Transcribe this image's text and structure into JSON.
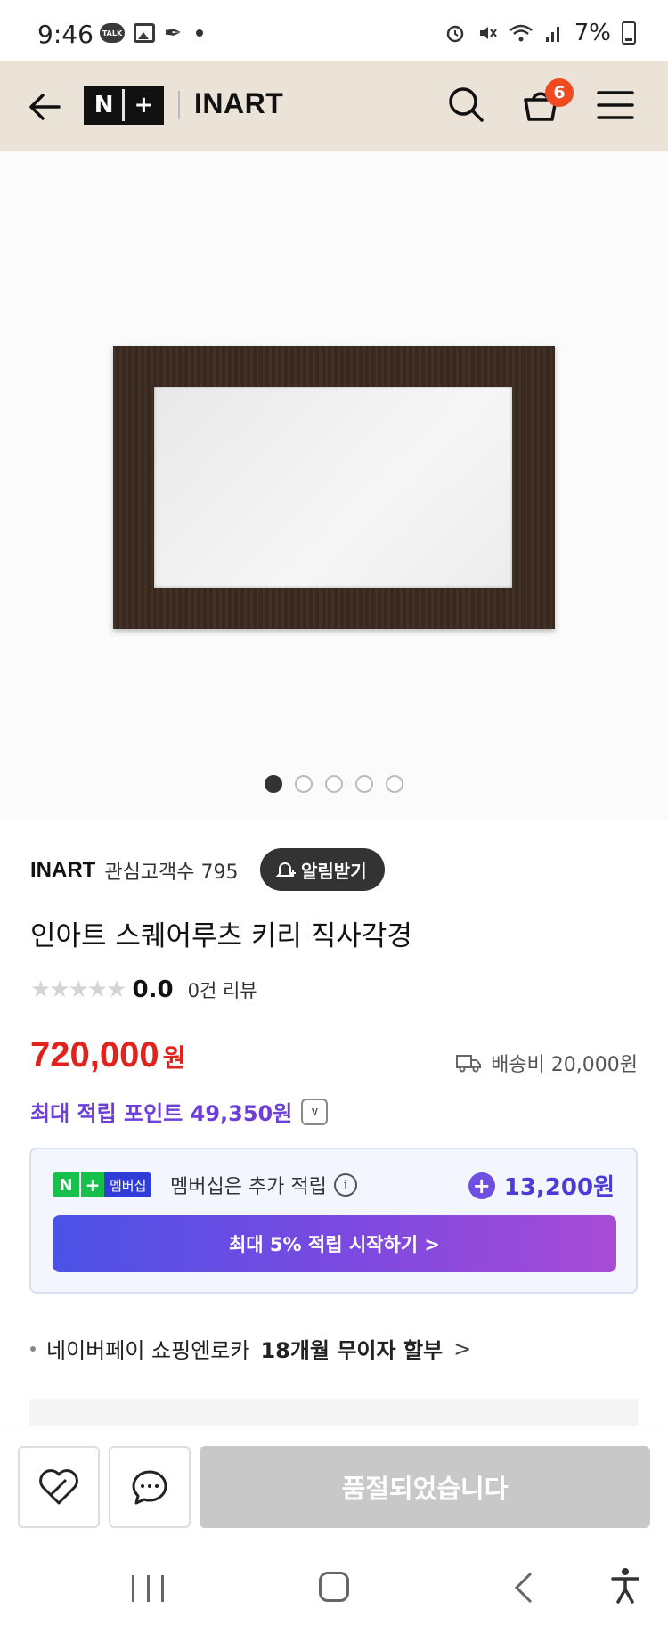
{
  "status_bar": {
    "time": "9:46",
    "talk_label": "TALK",
    "battery": "7%"
  },
  "header": {
    "logo": "N+",
    "logo_n": "N",
    "logo_plus": "+",
    "store_name": "INART",
    "cart_count": "6",
    "bg_color": "#ebe3d8"
  },
  "gallery": {
    "image_count": 5,
    "active_index": 0
  },
  "product": {
    "seller": "INART",
    "fans": "관심고객수 795",
    "alarm_label": "알림받기",
    "title": "인아트 스퀘어루츠 키리 직사각경",
    "stars": "★★★★★",
    "rating": "0.0",
    "reviews": "0건 리뷰",
    "price": "720,000",
    "currency": "원",
    "shipping": "배송비 20,000원",
    "points": "최대 적립 포인트 49,350원",
    "price_color": "#e0231c",
    "points_color": "#6e3fd8"
  },
  "membership": {
    "badge_n": "N",
    "badge_plus": "+",
    "badge_label": "멤버십",
    "text": "멤버십은 추가 적립",
    "info_icon": "i",
    "amount": "13,200원",
    "cta": "최대 5% 적립 시작하기 >"
  },
  "pay": {
    "text_prefix": "네이버페이 쇼핑엔로카",
    "text_bold": "18개월 무이자 할부",
    "chevron": ">"
  },
  "action_bar": {
    "soldout_label": "품절되었습니다"
  }
}
